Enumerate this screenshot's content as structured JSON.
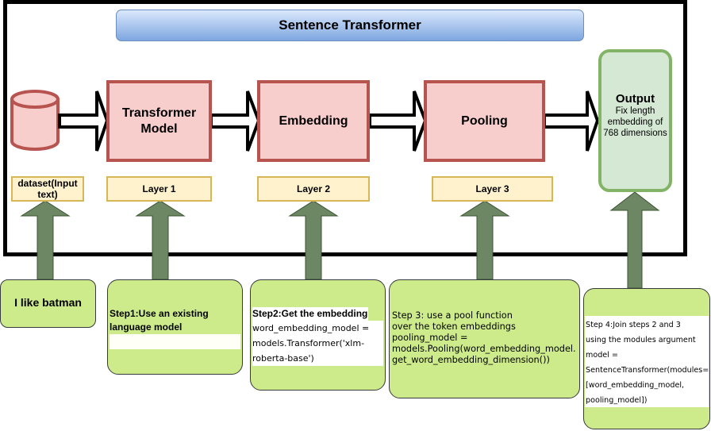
{
  "title": "Sentence Transformer",
  "colors": {
    "process_fill": "#f8cecc",
    "process_border": "#b85450",
    "layer_fill": "#fff2cc",
    "layer_border": "#d6b656",
    "output_fill": "#d5e8d4",
    "output_border": "#82b366",
    "note_fill": "#cdeb8b",
    "up_arrow": "#6d8764",
    "title_gradient_top": "#dae8fc",
    "title_gradient_bottom": "#7ea6e0"
  },
  "pipeline": {
    "input_icon": "database-cylinder-icon",
    "blocks": [
      {
        "label": "Transformer Model"
      },
      {
        "label": "Embedding"
      },
      {
        "label": "Pooling"
      }
    ],
    "output": {
      "title": "Output",
      "subtitle": "Fix length embedding of 768 dimensions"
    }
  },
  "layers": [
    {
      "label": "dataset(Input text)"
    },
    {
      "label": "Layer 1"
    },
    {
      "label": "Layer 2"
    },
    {
      "label": "Layer 3"
    }
  ],
  "notes": [
    {
      "lines": [
        "I like batman"
      ]
    },
    {
      "lines": [
        "Step1:Use an existing",
        "language model"
      ]
    },
    {
      "heading": "Step2:Get the embedding",
      "lines": [
        "word_embedding_model =",
        "models.Transformer('xlm-",
        "roberta-base')"
      ]
    },
    {
      "lines": [
        "Step 3: use a pool function",
        "over the token embeddings",
        "pooling_model =",
        "models.Pooling(word_embedding_model.",
        "get_word_embedding_dimension())"
      ]
    },
    {
      "lines": [
        "Step 4:Join steps 2 and 3",
        "using the modules argument",
        "model =",
        "SentenceTransformer(modules=",
        "[word_embedding_model,",
        "pooling_model])"
      ]
    }
  ]
}
